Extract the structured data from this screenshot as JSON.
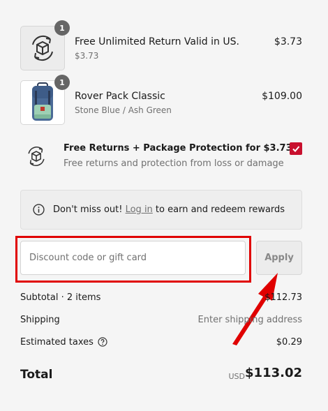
{
  "items": [
    {
      "quantity": "1",
      "title": "Free Unlimited Return Valid in US.",
      "subtitle": "$3.73",
      "price": "$3.73",
      "image_icon": "return-box-icon"
    },
    {
      "quantity": "1",
      "title": "Rover Pack Classic",
      "subtitle": "Stone Blue / Ash Green",
      "price": "$109.00",
      "image_icon": "backpack-image"
    }
  ],
  "protection": {
    "title": "Free Returns + Package Protection for $3.73",
    "subtitle": "Free returns and protection from loss or damage",
    "checked": true,
    "accent_color": "#c8102e"
  },
  "rewards": {
    "prefix": "Don't miss out! ",
    "link": "Log in",
    "suffix": " to earn and redeem rewards"
  },
  "discount": {
    "placeholder": "Discount code or gift card",
    "value": "",
    "apply_label": "Apply"
  },
  "summary": {
    "subtotal_label": "Subtotal · 2 items",
    "subtotal_value": "$112.73",
    "shipping_label": "Shipping",
    "shipping_value": "Enter shipping address",
    "taxes_label": "Estimated taxes",
    "taxes_value": "$0.29",
    "total_label": "Total",
    "total_currency": "USD",
    "total_value": "$113.02"
  },
  "annotation": {
    "highlight_color": "#e00000"
  }
}
